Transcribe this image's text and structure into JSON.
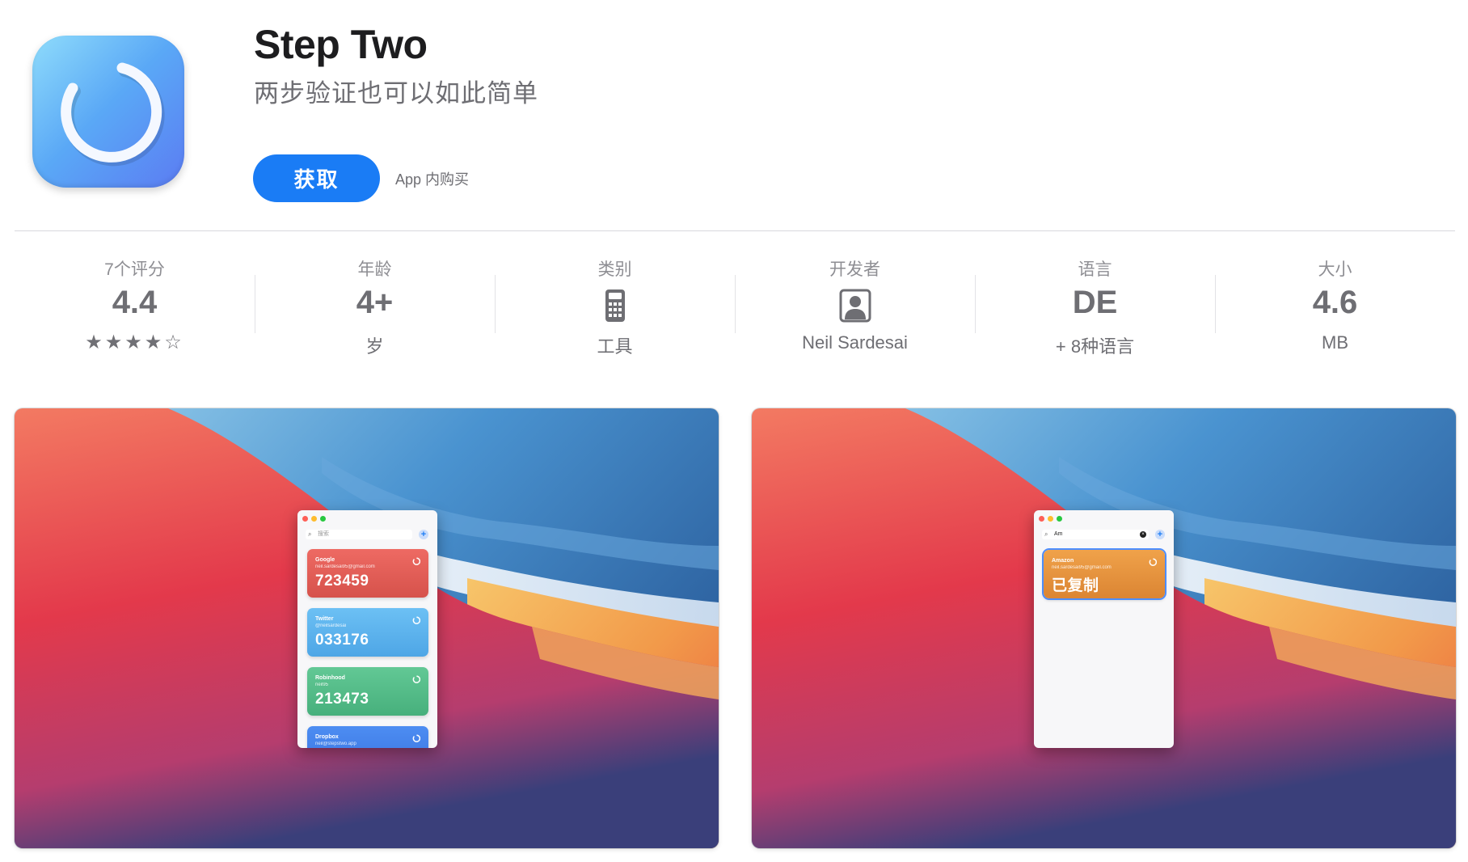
{
  "app": {
    "title": "Step Two",
    "subtitle": "两步验证也可以如此简单",
    "get_label": "获取",
    "iap_note": "App 内购买",
    "icon": "step-two-app-icon",
    "accent": "#1a7cf5"
  },
  "info": {
    "ratings": {
      "label": "7个评分",
      "value": "4.4",
      "stars": "★★★★☆",
      "rating": 4.4
    },
    "age": {
      "label": "年龄",
      "value": "4+",
      "sub": "岁"
    },
    "category": {
      "label": "类别",
      "icon": "calculator-icon",
      "sub": "工具"
    },
    "developer": {
      "label": "开发者",
      "icon": "person-icon",
      "sub": "Neil Sardesai"
    },
    "language": {
      "label": "语言",
      "value": "DE",
      "sub": "+ 8种语言"
    },
    "size": {
      "label": "大小",
      "value": "4.6",
      "sub": "MB"
    }
  },
  "screenshots": [
    {
      "search_placeholder": "搜索",
      "cards": [
        {
          "name": "Google",
          "account": "neil.sardesai95@gmail.com",
          "code": "723459",
          "color": "#e05d56"
        },
        {
          "name": "Twitter",
          "account": "@neilsardesai",
          "code": "033176",
          "color": "#5cb3ee"
        },
        {
          "name": "Robinhood",
          "account": "neil95",
          "code": "213473",
          "color": "#55bd88"
        },
        {
          "name": "Dropbox",
          "account": "neil@stepstwo.app",
          "code": "",
          "color": "#4580ea"
        }
      ]
    },
    {
      "search_value": "Am",
      "cards": [
        {
          "name": "Amazon",
          "account": "neil.sardesai95@gmail.com",
          "code": "已复制",
          "color": "#e5933f"
        }
      ]
    }
  ]
}
